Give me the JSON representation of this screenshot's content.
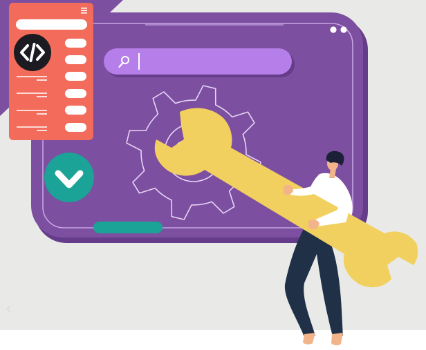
{
  "illustration": {
    "colors": {
      "background": "#e9eae8",
      "footer": "#ffffff",
      "window": "#7c4fa0",
      "window_shadow": "#653c89",
      "search_bar": "#b57ee8",
      "sidebar_panel": "#f26b5b",
      "code_badge": "#1d1b22",
      "check_badge": "#1aa396",
      "progress_bar": "#1aa396",
      "wrench": "#f2d060",
      "shirt": "#ffffff",
      "trousers": "#1f3047",
      "hair": "#1c2036",
      "skin": "#f2b48a"
    },
    "icons": {
      "search": "search-icon",
      "code": "code-brackets-icon",
      "check": "chevron-down-check-icon",
      "menu": "hamburger-menu-icon",
      "gear": "gear-icon",
      "wrench": "wrench-icon",
      "window_dots": "dots-icon",
      "carousel_prev": "chevron-left-icon"
    },
    "carousel_prev_glyph": "‹",
    "search_value": ""
  }
}
